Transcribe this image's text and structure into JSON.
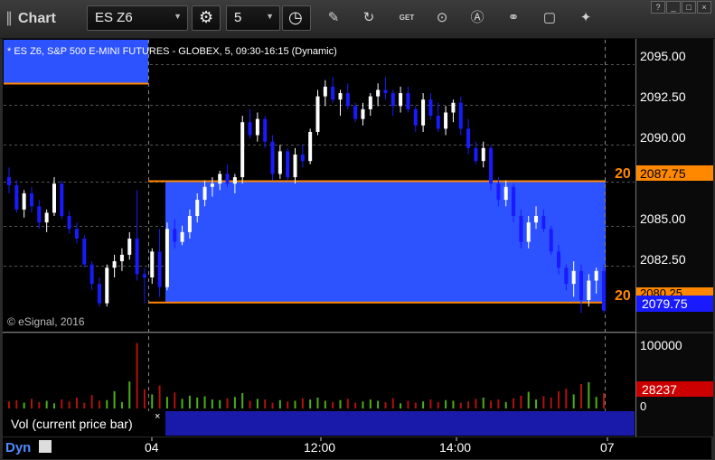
{
  "window": {
    "title": "Chart",
    "win_buttons": [
      "?",
      "_",
      "□",
      "×"
    ]
  },
  "toolbar": {
    "symbol": "ES Z6",
    "interval": "5",
    "icons": [
      "period-icon",
      "clock-icon",
      "pencil-icon",
      "refresh-icon",
      "get-icon",
      "play-icon",
      "alert-icon",
      "link-icon",
      "chat-icon",
      "twitter-icon"
    ],
    "get_label": "GET"
  },
  "chart": {
    "header": "* ES Z6, S&P 500 E-MINI FUTURES - GLOBEX, 5, 09:30-16:15 (Dynamic)",
    "copyright": "© eSignal, 2016",
    "price_labels": [
      "2095.00",
      "2092.50",
      "2090.00",
      "2087.75",
      "2085.00",
      "2082.50",
      "2080.25",
      "2079.75"
    ],
    "level_tags": [
      "20",
      "20"
    ],
    "volume_pane_title": "Vol (current price bar)",
    "volume_labels": [
      "100000",
      "28237",
      "0"
    ],
    "time_labels": [
      "04",
      "12:00",
      "14:00",
      "07"
    ],
    "status": "Dyn",
    "colors": {
      "up": "#ffffff",
      "down": "#1a1aff",
      "zone": "#2d52ff",
      "level": "#ff8800",
      "current_price": "#1a1aff",
      "volume_current": "#cc0000"
    }
  },
  "chart_data": {
    "type": "candlestick",
    "symbol": "ES Z6",
    "interval": "5",
    "ylim": [
      2078.5,
      2096.5
    ],
    "levels": [
      2087.75,
      2080.25
    ],
    "last": 2079.75,
    "bars": [
      [
        2088.0,
        2088.6,
        2087.0,
        2087.5
      ],
      [
        2087.5,
        2087.8,
        2085.8,
        2086.0
      ],
      [
        2086.0,
        2087.2,
        2085.5,
        2087.0
      ],
      [
        2087.0,
        2087.4,
        2085.8,
        2086.2
      ],
      [
        2086.2,
        2086.6,
        2084.8,
        2085.2
      ],
      [
        2085.2,
        2086.0,
        2084.6,
        2085.8
      ],
      [
        2085.8,
        2088.0,
        2085.6,
        2087.6
      ],
      [
        2087.6,
        2087.8,
        2085.4,
        2085.6
      ],
      [
        2085.6,
        2085.9,
        2084.5,
        2084.8
      ],
      [
        2084.8,
        2085.2,
        2083.9,
        2084.2
      ],
      [
        2084.2,
        2084.4,
        2082.4,
        2082.6
      ],
      [
        2082.6,
        2082.8,
        2081.0,
        2081.4
      ],
      [
        2081.4,
        2081.8,
        2080.0,
        2080.2
      ],
      [
        2080.2,
        2082.6,
        2080.0,
        2082.4
      ],
      [
        2082.4,
        2083.2,
        2081.8,
        2082.8
      ],
      [
        2082.8,
        2083.6,
        2082.2,
        2083.2
      ],
      [
        2083.2,
        2084.6,
        2082.9,
        2084.2
      ],
      [
        2084.2,
        2087.2,
        2081.6,
        2082.0
      ],
      [
        2082.0,
        2082.4,
        2080.2,
        2081.8
      ],
      [
        2081.8,
        2083.6,
        2081.4,
        2083.4
      ],
      [
        2083.4,
        2084.8,
        2080.6,
        2081.2
      ],
      [
        2081.2,
        2085.2,
        2081.0,
        2084.8
      ],
      [
        2084.8,
        2085.4,
        2083.6,
        2084.0
      ],
      [
        2084.0,
        2085.0,
        2083.8,
        2084.6
      ],
      [
        2084.6,
        2086.0,
        2084.2,
        2085.6
      ],
      [
        2085.6,
        2087.0,
        2085.2,
        2086.6
      ],
      [
        2086.6,
        2087.8,
        2086.2,
        2087.4
      ],
      [
        2087.4,
        2088.0,
        2086.8,
        2087.6
      ],
      [
        2087.6,
        2088.4,
        2087.2,
        2088.2
      ],
      [
        2088.2,
        2088.8,
        2087.4,
        2087.6
      ],
      [
        2087.6,
        2088.2,
        2087.0,
        2088.0
      ],
      [
        2088.0,
        2091.8,
        2087.6,
        2091.4
      ],
      [
        2091.4,
        2092.2,
        2090.4,
        2090.6
      ],
      [
        2090.6,
        2092.0,
        2090.2,
        2091.6
      ],
      [
        2091.6,
        2091.8,
        2089.8,
        2090.2
      ],
      [
        2090.2,
        2090.6,
        2087.8,
        2088.2
      ],
      [
        2088.2,
        2090.0,
        2087.9,
        2089.6
      ],
      [
        2089.6,
        2089.8,
        2087.8,
        2088.0
      ],
      [
        2088.0,
        2089.8,
        2087.6,
        2089.4
      ],
      [
        2089.4,
        2090.0,
        2088.6,
        2089.0
      ],
      [
        2089.0,
        2091.0,
        2088.8,
        2090.8
      ],
      [
        2090.8,
        2093.4,
        2090.6,
        2093.0
      ],
      [
        2093.0,
        2094.0,
        2092.4,
        2093.6
      ],
      [
        2093.6,
        2094.2,
        2092.6,
        2092.8
      ],
      [
        2092.8,
        2093.4,
        2091.8,
        2093.2
      ],
      [
        2093.2,
        2093.8,
        2092.2,
        2092.4
      ],
      [
        2092.4,
        2092.6,
        2091.4,
        2091.6
      ],
      [
        2091.6,
        2092.6,
        2091.2,
        2092.2
      ],
      [
        2092.2,
        2093.2,
        2091.8,
        2093.0
      ],
      [
        2093.0,
        2093.8,
        2092.4,
        2093.4
      ],
      [
        2093.4,
        2094.2,
        2092.8,
        2093.2
      ],
      [
        2093.2,
        2093.4,
        2091.8,
        2092.4
      ],
      [
        2092.4,
        2093.6,
        2092.0,
        2093.2
      ],
      [
        2093.2,
        2093.6,
        2092.0,
        2092.2
      ],
      [
        2092.2,
        2092.4,
        2090.8,
        2091.2
      ],
      [
        2091.2,
        2093.2,
        2090.8,
        2092.8
      ],
      [
        2092.8,
        2093.2,
        2091.6,
        2091.8
      ],
      [
        2091.8,
        2092.6,
        2090.8,
        2091.0
      ],
      [
        2091.0,
        2092.4,
        2090.6,
        2092.0
      ],
      [
        2092.0,
        2092.8,
        2091.4,
        2092.6
      ],
      [
        2092.6,
        2093.0,
        2090.6,
        2091.0
      ],
      [
        2091.0,
        2091.6,
        2089.4,
        2089.8
      ],
      [
        2089.8,
        2090.2,
        2088.8,
        2089.0
      ],
      [
        2089.0,
        2090.2,
        2088.6,
        2089.8
      ],
      [
        2089.8,
        2090.0,
        2087.2,
        2087.6
      ],
      [
        2087.6,
        2088.0,
        2086.2,
        2086.6
      ],
      [
        2086.6,
        2087.8,
        2086.2,
        2087.4
      ],
      [
        2087.4,
        2087.6,
        2085.2,
        2085.6
      ],
      [
        2085.6,
        2086.0,
        2083.6,
        2084.0
      ],
      [
        2084.0,
        2085.6,
        2083.6,
        2085.2
      ],
      [
        2085.2,
        2086.2,
        2084.8,
        2085.6
      ],
      [
        2085.6,
        2086.0,
        2084.6,
        2084.8
      ],
      [
        2084.8,
        2085.0,
        2083.2,
        2083.4
      ],
      [
        2083.4,
        2083.8,
        2082.0,
        2082.4
      ],
      [
        2082.4,
        2082.6,
        2081.0,
        2081.4
      ],
      [
        2081.4,
        2082.8,
        2080.6,
        2082.2
      ],
      [
        2082.2,
        2082.6,
        2079.6,
        2080.4
      ],
      [
        2080.4,
        2082.0,
        2080.0,
        2081.6
      ],
      [
        2081.6,
        2082.4,
        2080.8,
        2082.2
      ],
      [
        2082.2,
        2082.6,
        2079.6,
        2079.75
      ]
    ],
    "volume": [
      11000,
      13000,
      9000,
      15000,
      10000,
      12000,
      8000,
      14000,
      11000,
      17000,
      9000,
      21000,
      12000,
      13000,
      27000,
      10000,
      42000,
      102000,
      30000,
      22000,
      36000,
      18000,
      25000,
      15000,
      20000,
      17000,
      19000,
      14000,
      13000,
      16000,
      18000,
      24000,
      12000,
      15000,
      14000,
      9000,
      13000,
      11000,
      12000,
      16000,
      14000,
      17000,
      12000,
      10000,
      13000,
      15000,
      9000,
      11000,
      14000,
      12000,
      10000,
      16000,
      8000,
      12000,
      9000,
      11000,
      14000,
      10000,
      13000,
      12000,
      9000,
      11000,
      15000,
      17000,
      12000,
      14000,
      10000,
      16000,
      20000,
      26000,
      14000,
      19000,
      17000,
      27000,
      31000,
      22000,
      38000,
      41000,
      18000,
      24000
    ]
  }
}
